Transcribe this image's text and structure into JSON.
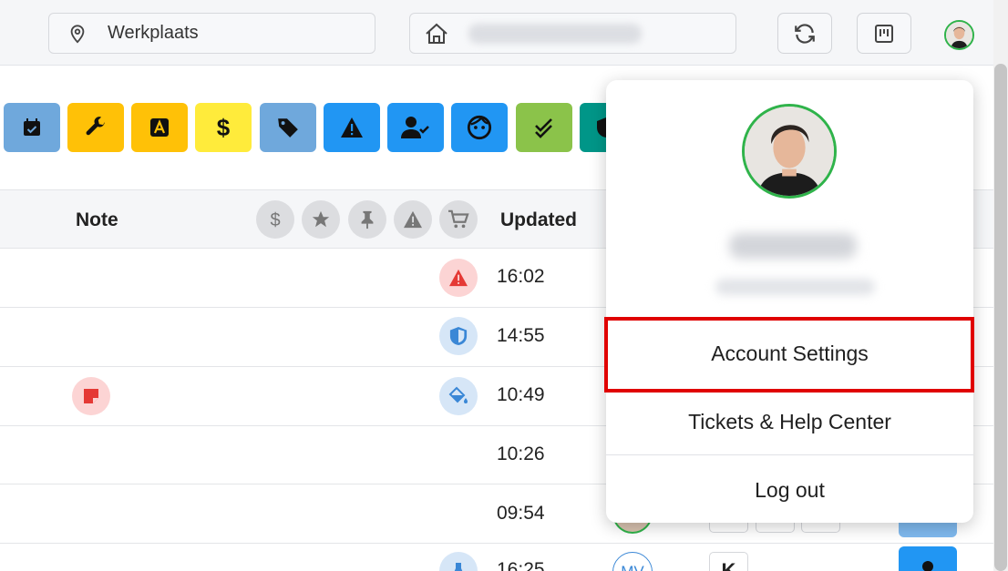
{
  "header": {
    "location_label": "Werkplaats",
    "location_icon": "map-pin-icon",
    "home_icon": "home-icon",
    "refresh_icon": "refresh-icon",
    "board_icon": "board-icon"
  },
  "toolbar": {
    "items": [
      {
        "icon": "calendar-check-icon",
        "color": "#6fa8dc"
      },
      {
        "icon": "wrench-icon",
        "color": "#ffc107"
      },
      {
        "icon": "letter-a-icon",
        "color": "#ffc107"
      },
      {
        "icon": "dollar-icon",
        "color": "#ffeb3b"
      },
      {
        "icon": "tag-icon",
        "color": "#6fa8dc"
      },
      {
        "icon": "warning-icon",
        "color": "#2196f3"
      },
      {
        "icon": "user-check-icon",
        "color": "#2196f3"
      },
      {
        "icon": "face-icon",
        "color": "#2196f3"
      },
      {
        "icon": "double-check-icon",
        "color": "#8bc34a"
      },
      {
        "icon": "shield-icon",
        "color": "#009688"
      }
    ]
  },
  "table": {
    "headers": {
      "note": "Note",
      "updated": "Updated"
    },
    "header_icons": [
      "dollar-icon",
      "star-icon",
      "pin-icon",
      "warning-icon",
      "cart-icon"
    ],
    "rows": [
      {
        "time": "16:02",
        "status_icon": "warning-icon"
      },
      {
        "time": "14:55",
        "status_icon": "shield-icon"
      },
      {
        "time": "10:49",
        "status_icon": "paint-bucket-icon",
        "note_icon": "sticky-note-icon"
      },
      {
        "time": "10:26"
      },
      {
        "time": "09:54"
      },
      {
        "time": "16:25",
        "status_icon": "flask-icon",
        "initials": "MV",
        "badge": "K"
      }
    ]
  },
  "account_menu": {
    "items": [
      {
        "label": "Account Settings"
      },
      {
        "label": "Tickets & Help Center"
      },
      {
        "label": "Log out"
      }
    ]
  }
}
